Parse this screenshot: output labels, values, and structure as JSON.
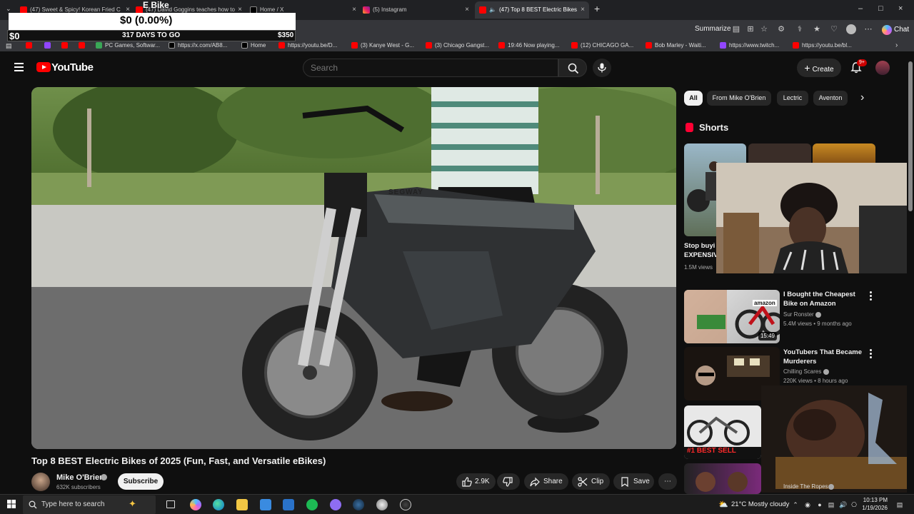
{
  "browser": {
    "tabs": [
      {
        "title": "(47) Sweet & Spicy! Korean Fried C",
        "icon": "youtube-favicon"
      },
      {
        "title": "(47) David Goggins teaches how to",
        "icon": "youtube-favicon"
      },
      {
        "title": "Home / X",
        "icon": "x-favicon"
      },
      {
        "title": "(5) Instagram",
        "icon": "instagram-favicon"
      },
      {
        "title": "(47) Top 8 BEST Electric Bikes",
        "icon": "youtube-favicon",
        "active": true
      }
    ],
    "summarize_label": "Summarize",
    "chat_label": "Chat",
    "bookmarks": [
      {
        "label": "",
        "icon": "youtube-favicon"
      },
      {
        "label": "",
        "icon": "twitch-favicon"
      },
      {
        "label": "",
        "icon": "youtube-favicon"
      },
      {
        "label": "",
        "icon": "youtube-favicon"
      },
      {
        "label": "PC Games, Softwar...",
        "icon": "puzzle-favicon"
      },
      {
        "label": "https://x.com/AB8...",
        "icon": "x-favicon"
      },
      {
        "label": "Home",
        "icon": "x-favicon"
      },
      {
        "label": "https://youtu.be/D...",
        "icon": "youtube-favicon"
      },
      {
        "label": "(3) Kanye West - G...",
        "icon": "youtube-favicon"
      },
      {
        "label": "(3) Chicago Gangst...",
        "icon": "youtube-favicon"
      },
      {
        "label": "19:46 Now playing...",
        "icon": "youtube-favicon"
      },
      {
        "label": "(12) CHICAGO GA...",
        "icon": "youtube-favicon"
      },
      {
        "label": "Bob Marley - Waiti...",
        "icon": "youtube-favicon"
      },
      {
        "label": "https://www.twitch...",
        "icon": "twitch-favicon"
      },
      {
        "label": "https://youtu.be/bl...",
        "icon": "youtube-favicon"
      }
    ]
  },
  "overlay": {
    "label": "E Bike",
    "value": "$0 (0.00%)",
    "left": "$0",
    "days": "317 DAYS TO GO",
    "goal": "$350",
    "progress_fraction": 0.0
  },
  "youtube": {
    "logo_text": "YouTube",
    "search_placeholder": "Search",
    "create_label": "Create",
    "notification_badge": "9+",
    "video": {
      "title": "Top 8 BEST Electric Bikes of 2025 (Fun, Fast, and Versatile eBikes)",
      "channel": "Mike O'Brien",
      "subscribers": "632K subscribers",
      "subscribe_label": "Subscribe",
      "likes": "2.9K",
      "share_label": "Share",
      "clip_label": "Clip",
      "save_label": "Save",
      "bike_brand": "SEGWAY"
    },
    "chips": [
      "All",
      "From Mike O'Brien",
      "Lectric",
      "Aventon"
    ],
    "shorts": {
      "title": "Shorts",
      "first_title": "Stop buyi EXPENSIV",
      "first_views": "1.5M views"
    },
    "recommendations": [
      {
        "title": "I Bought the Cheapest Bike on Amazon",
        "channel": "Sur Ronster",
        "meta": "5.4M views • 9 months ago",
        "duration": "15:49",
        "thumb_text": "amazon"
      },
      {
        "title": "YouTubers That Became Murderers",
        "channel": "Chilling Scares",
        "meta": "220K views • 8 hours ago"
      },
      {
        "title": "",
        "channel": "",
        "meta": "",
        "thumb_text": "#1 BEST SELL"
      },
      {
        "title": "",
        "channel": "Inside The Ropes",
        "meta": ""
      }
    ]
  },
  "taskbar": {
    "search_placeholder": "Type here to search",
    "weather": "21°C  Mostly cloudy",
    "time": "10:13 PM",
    "date": "1/19/2026"
  },
  "colors": {
    "youtube_red": "#ff0000",
    "background": "#0f0f0f",
    "chip_bg": "#272727"
  }
}
